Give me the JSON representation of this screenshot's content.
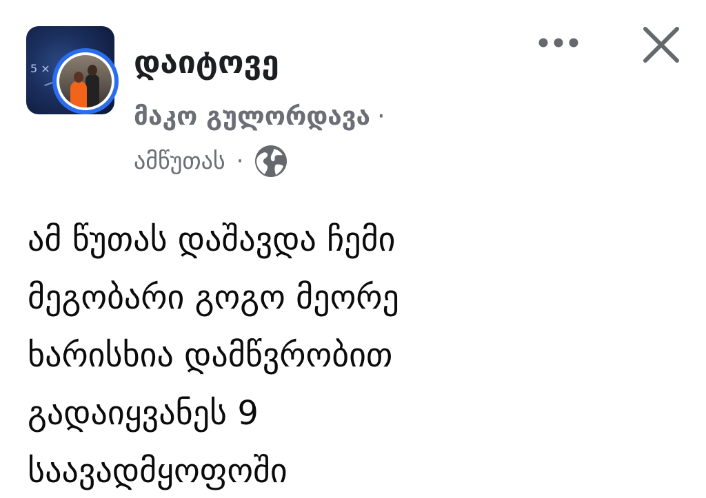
{
  "header": {
    "group_name": "დაიტოვე",
    "author": "მაკო გულორდავა",
    "separator": "·",
    "timestamp": "ამწუთას",
    "privacy_icon": "globe-icon",
    "more_icon": "more-horizontal-icon",
    "close_icon": "close-icon"
  },
  "post": {
    "lines": [
      "ამ წუთას დაშავდა ჩემი",
      "მეგობარი გოგო მეორე",
      "ხარისხია დამწვრობით",
      "გადაიყვანეს 9",
      "საავადმყოფოში"
    ]
  },
  "colors": {
    "title": "#1c1e21",
    "meta": "#6b6f75",
    "avatar_ring": "#2a6df0",
    "icon": "#65686c"
  }
}
